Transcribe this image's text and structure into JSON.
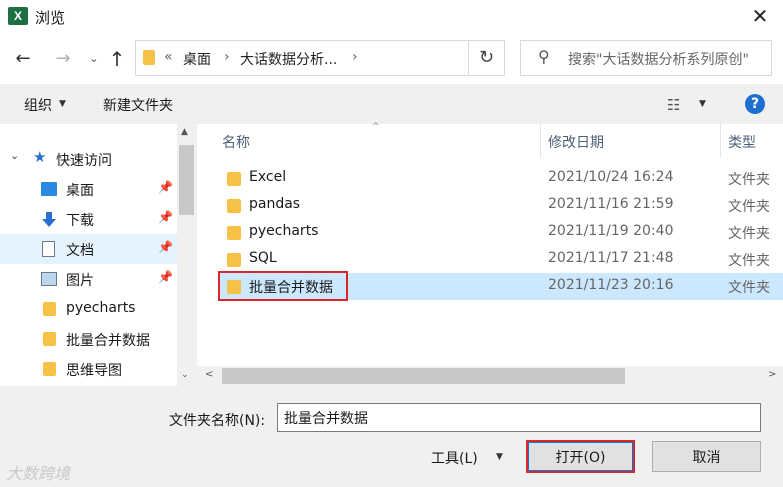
{
  "window": {
    "title": "浏览",
    "app_icon_letter": "X",
    "close_glyph": "✕"
  },
  "nav": {
    "back_glyph": "←",
    "forward_glyph": "→",
    "history_glyph": "⌄",
    "up_glyph": "↑",
    "breadcrumb_more": "«",
    "breadcrumbs": [
      "桌面",
      "大话数据分析..."
    ],
    "separator": "›",
    "refresh_glyph": "↻",
    "search_glyph": "⚲",
    "search_placeholder": "搜索\"大话数据分析系列原创\""
  },
  "toolbar": {
    "organize_label": "组织",
    "caret": "▼",
    "new_folder_label": "新建文件夹",
    "view_glyph": "☷",
    "help_glyph": "?"
  },
  "sidebar": {
    "expand_glyph": "⌄",
    "star_glyph": "★",
    "pin_glyph": "📌",
    "quick_access_label": "快速访问",
    "items": [
      {
        "label": "桌面",
        "icon": "desktop-icon",
        "pinned": true
      },
      {
        "label": "下载",
        "icon": "download-icon",
        "pinned": true
      },
      {
        "label": "文档",
        "icon": "document-icon",
        "pinned": true,
        "selected": true
      },
      {
        "label": "图片",
        "icon": "picture-icon",
        "pinned": true
      },
      {
        "label": "pyecharts",
        "icon": "folder-icon",
        "pinned": false
      },
      {
        "label": "批量合并数据",
        "icon": "folder-icon",
        "pinned": false
      },
      {
        "label": "思维导图",
        "icon": "folder-icon",
        "pinned": false
      }
    ],
    "scroll_up_glyph": "▲",
    "scroll_down_glyph": "⌄"
  },
  "filelist": {
    "columns": {
      "name": "名称",
      "modified": "修改日期",
      "type": "类型"
    },
    "sort_glyph": "^",
    "rows": [
      {
        "name": "Excel",
        "modified": "2021/10/24 16:24",
        "type": "文件夹"
      },
      {
        "name": "pandas",
        "modified": "2021/11/16 21:59",
        "type": "文件夹"
      },
      {
        "name": "pyecharts",
        "modified": "2021/11/19 20:40",
        "type": "文件夹"
      },
      {
        "name": "SQL",
        "modified": "2021/11/17 21:48",
        "type": "文件夹"
      },
      {
        "name": "批量合并数据",
        "modified": "2021/11/23 20:16",
        "type": "文件夹",
        "selected": true
      }
    ],
    "hscroll_left_glyph": "<",
    "hscroll_right_glyph": ">"
  },
  "footer": {
    "filename_label": "文件夹名称(N):",
    "filename_value": "批量合并数据",
    "tools_label": "工具(L)",
    "open_label": "打开(O)",
    "cancel_label": "取消",
    "watermark": "大数跨境"
  },
  "colors": {
    "selection": "#cce8ff",
    "highlight_border": "#d8262c",
    "folder": "#f5c146",
    "accent": "#1e6fd0"
  }
}
